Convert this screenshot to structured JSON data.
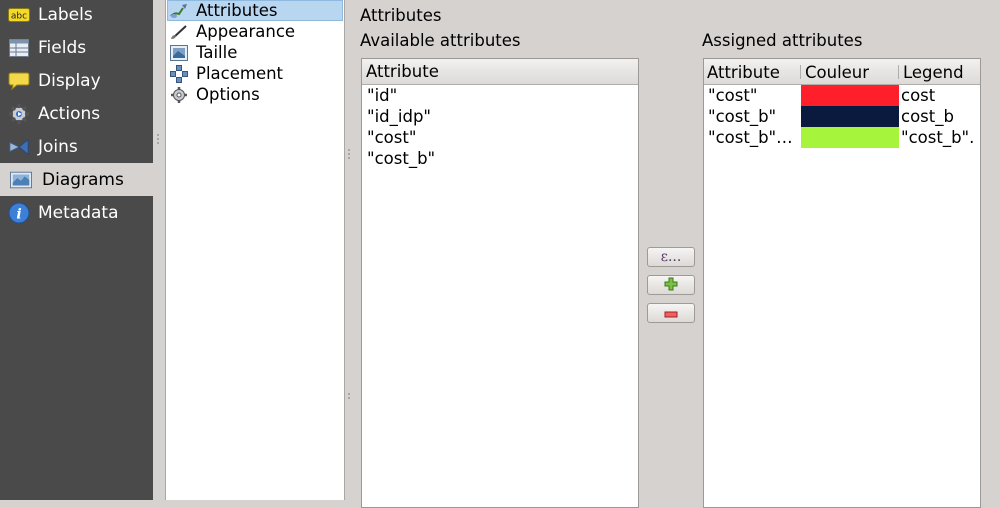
{
  "sidebar": {
    "items": [
      {
        "label": "Labels",
        "icon": "labels-abc-icon"
      },
      {
        "label": "Fields",
        "icon": "table-icon"
      },
      {
        "label": "Display",
        "icon": "speech-bubble-icon"
      },
      {
        "label": "Actions",
        "icon": "gear-icon"
      },
      {
        "label": "Joins",
        "icon": "join-icon"
      },
      {
        "label": "Diagrams",
        "icon": "diagram-icon",
        "selected": true
      },
      {
        "label": "Metadata",
        "icon": "info-icon"
      }
    ]
  },
  "tree": {
    "items": [
      {
        "label": "Attributes",
        "icon": "attributes-brush-icon",
        "selected": true
      },
      {
        "label": "Appearance",
        "icon": "brush-icon"
      },
      {
        "label": "Taille",
        "icon": "size-icon"
      },
      {
        "label": "Placement",
        "icon": "placement-icon"
      },
      {
        "label": "Options",
        "icon": "options-gear-icon"
      }
    ]
  },
  "main": {
    "section_title": "Attributes",
    "available_title": "Available attributes",
    "assigned_title": "Assigned attributes",
    "available": {
      "header": "Attribute",
      "rows": [
        "\"id\"",
        "\"id_idp\"",
        "\"cost\"",
        "\"cost_b\""
      ]
    },
    "buttons": {
      "expression": "ε...",
      "add": "+",
      "remove": "−"
    },
    "assigned": {
      "headers": [
        "Attribute",
        "Couleur",
        "Legend"
      ],
      "rows": [
        {
          "attribute": "\"cost\"",
          "color": "#ff1f2a",
          "legend": "cost"
        },
        {
          "attribute": "\"cost_b\"",
          "color": "#0a1a3e",
          "legend": "cost_b"
        },
        {
          "attribute": "\"cost_b\"…",
          "color": "#a6f53c",
          "legend": "\"cost_b\"."
        }
      ]
    }
  },
  "colors": {
    "sidebar_bg": "#4a4a4a",
    "selection_bg": "#b8d6f0",
    "window_bg": "#d6d2d0"
  }
}
